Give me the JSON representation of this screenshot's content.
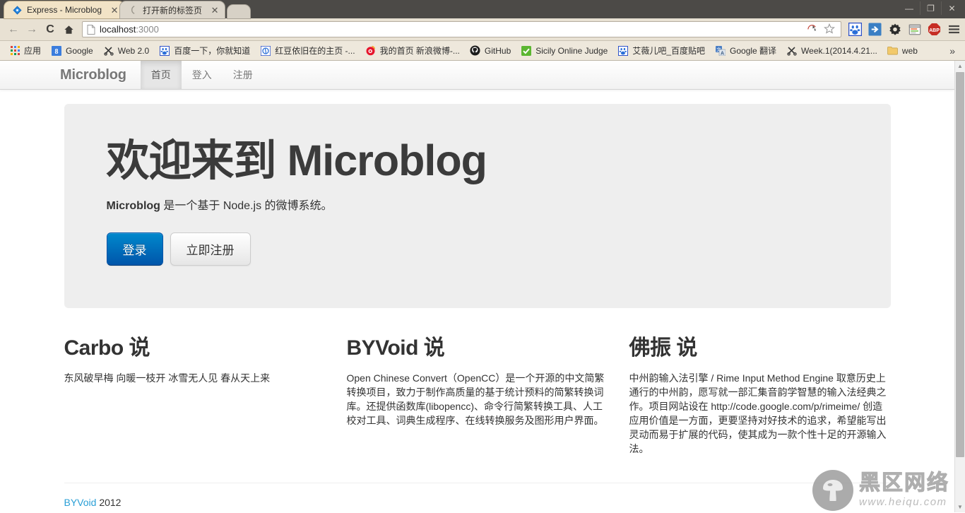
{
  "browser": {
    "tabs": [
      {
        "title": "Express - Microblog",
        "favicon": "express-diamond-icon",
        "active": true
      },
      {
        "title": "打开新的标签页",
        "favicon": "page-icon",
        "active": false
      }
    ],
    "new_tab_label": "+",
    "window_controls": {
      "minimize": "—",
      "maximize": "❐",
      "close": "✕"
    },
    "nav": {
      "back": "←",
      "forward": "→",
      "reload": "C",
      "home": "⌂"
    },
    "url": {
      "host": "localhost",
      "port": ":3000",
      "page_icon": "document-icon"
    },
    "url_right_icons": [
      "translate-icon",
      "bookmark-star-icon"
    ],
    "extension_icons": [
      "baidu-paw-icon",
      "blue-arrow-icon",
      "gear-icon",
      "list-window-icon",
      "abp-icon",
      "menu-icon"
    ],
    "abp_label": "ABP",
    "bookmarks": [
      {
        "label": "应用",
        "icon": "apps-grid-icon"
      },
      {
        "label": "Google",
        "icon": "google-8-icon"
      },
      {
        "label": "Web 2.0",
        "icon": "scissors-icon"
      },
      {
        "label": "百度一下，你就知道",
        "icon": "baidu-paw-icon"
      },
      {
        "label": "红豆依旧在的主页 -...",
        "icon": "blue-circle-icon"
      },
      {
        "label": "我的首页 新浪微博-...",
        "icon": "weibo-eye-icon"
      },
      {
        "label": "GitHub",
        "icon": "github-icon"
      },
      {
        "label": "Sicily Online Judge",
        "icon": "green-check-icon"
      },
      {
        "label": "艾薇儿吧_百度贴吧",
        "icon": "baidu-paw-icon"
      },
      {
        "label": "Google 翻译",
        "icon": "translate-a-icon"
      },
      {
        "label": "Week.1(2014.4.21...",
        "icon": "scissors-icon"
      },
      {
        "label": "web",
        "icon": "folder-icon"
      }
    ],
    "bookmarks_overflow": "»"
  },
  "site": {
    "navbar": {
      "brand": "Microblog",
      "links": [
        {
          "label": "首页",
          "active": true
        },
        {
          "label": "登入",
          "active": false
        },
        {
          "label": "注册",
          "active": false
        }
      ]
    },
    "hero": {
      "heading": "欢迎来到 Microblog",
      "lead_strong": "Microblog",
      "lead_rest": " 是一个基于 Node.js 的微博系统。",
      "primary_button": "登录",
      "secondary_button": "立即注册"
    },
    "columns": [
      {
        "heading": "Carbo 说",
        "body": "东风破早梅 向暖一枝开 冰雪无人见 春从天上来"
      },
      {
        "heading": "BYVoid 说",
        "body": "Open Chinese Convert（OpenCC）是一个开源的中文简繁转换项目，致力于制作高质量的基于统计预料的简繁转换词库。还提供函数库(libopencc)、命令行简繁转换工具、人工校对工具、词典生成程序、在线转换服务及图形用户界面。"
      },
      {
        "heading": "佛振 说",
        "body": "中州韵输入法引擎 / Rime Input Method Engine 取意历史上通行的中州韵，愿写就一部汇集音韵学智慧的输入法经典之作。项目网站设在 http://code.google.com/p/rimeime/ 创造应用价值是一方面，更要坚持对好技术的追求，希望能写出灵动而易于扩展的代码，使其成为一款个性十足的开源输入法。"
      }
    ],
    "footer": {
      "link": "BYVoid",
      "year": " 2012"
    }
  },
  "watermark": {
    "chinese": "黑区网络",
    "url": "www.heiqu.com",
    "logo": "mushroom-icon"
  },
  "colors": {
    "accent_blue": "#0088cc",
    "link_blue": "#2a9fd6",
    "hero_bg": "#eeeeee",
    "chrome_tan": "#e8e1d3",
    "active_tab": "#f2e3c6"
  }
}
